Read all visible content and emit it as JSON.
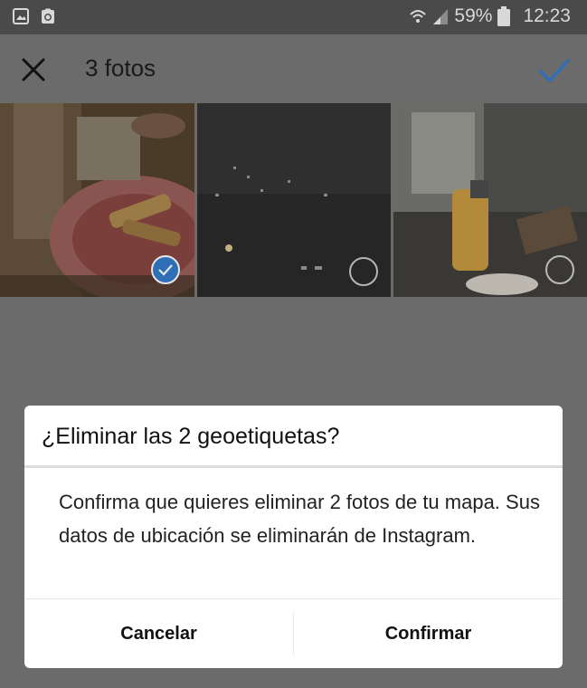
{
  "status_bar": {
    "battery": "59%",
    "time": "12:23",
    "icons": [
      "gallery-icon",
      "clipboard-recycle-icon",
      "wifi-icon",
      "signal-icon",
      "battery-icon"
    ]
  },
  "header": {
    "title": "3 fotos",
    "close_icon": "close-icon",
    "confirm_icon": "check-icon",
    "accent_color": "#2f6fb6"
  },
  "photos": [
    {
      "name": "food-plate-photo",
      "selected": true
    },
    {
      "name": "night-city-photo",
      "selected": false
    },
    {
      "name": "table-bottle-photo",
      "selected": false
    }
  ],
  "dialog": {
    "title": "¿Eliminar las 2 geoetiquetas?",
    "message": "Confirma que quieres eliminar 2 fotos de tu mapa. Sus datos de ubicación se eliminarán de Instagram.",
    "cancel_label": "Cancelar",
    "confirm_label": "Confirmar"
  }
}
